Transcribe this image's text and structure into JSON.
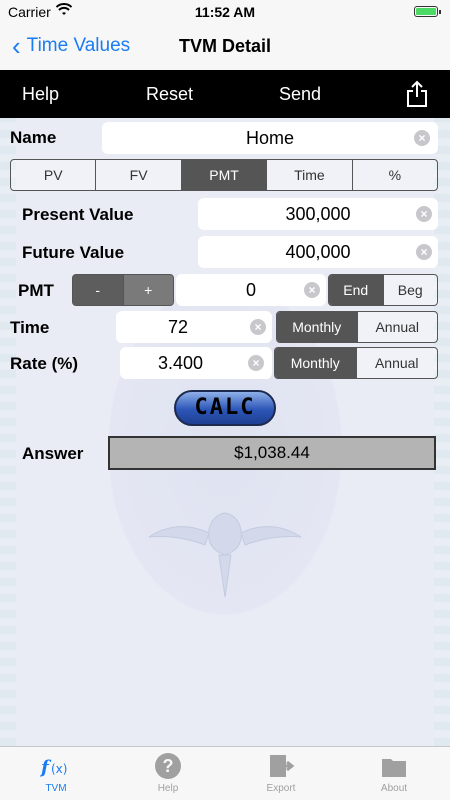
{
  "status": {
    "carrier": "Carrier",
    "time": "11:52 AM"
  },
  "nav": {
    "back_label": "Time Values",
    "title": "TVM Detail"
  },
  "toolbar": {
    "help": "Help",
    "reset": "Reset",
    "send": "Send",
    "share_icon": "share-icon"
  },
  "form": {
    "name_label": "Name",
    "name_value": "Home",
    "modes": [
      "PV",
      "FV",
      "PMT",
      "Time",
      "%"
    ],
    "active_mode": "PMT",
    "present_value_label": "Present Value",
    "present_value": "300,000",
    "future_value_label": "Future Value",
    "future_value": "400,000",
    "pmt_label": "PMT",
    "pmt_minus": "-",
    "pmt_plus": "+",
    "pmt_value": "0",
    "pmt_timing": [
      "End",
      "Beg"
    ],
    "pmt_timing_selected": "End",
    "time_label": "Time",
    "time_value": "72",
    "time_period": [
      "Monthly",
      "Annual"
    ],
    "time_period_selected": "Monthly",
    "rate_label": "Rate (%)",
    "rate_value": "3.400",
    "rate_period": [
      "Monthly",
      "Annual"
    ],
    "rate_period_selected": "Monthly",
    "calc_label": "CALC",
    "answer_label": "Answer",
    "answer_value": "$1,038.44"
  },
  "tabs": [
    {
      "label": "TVM",
      "icon": "fx-icon",
      "active": true
    },
    {
      "label": "Help",
      "icon": "question-icon",
      "active": false
    },
    {
      "label": "Export",
      "icon": "export-icon",
      "active": false
    },
    {
      "label": "About",
      "icon": "folder-icon",
      "active": false
    }
  ],
  "colors": {
    "accent": "#1a7cf5",
    "toolbar": "#000000",
    "selected_segment": "#555555"
  }
}
